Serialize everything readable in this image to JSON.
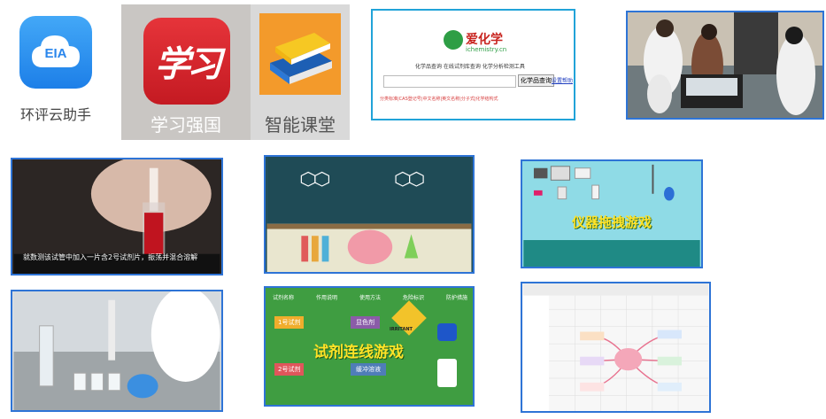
{
  "apps": {
    "eia": {
      "icon_text": "EIA",
      "label": "环评云助手"
    },
    "xuexi": {
      "icon_text": "学习",
      "label": "学习强国"
    },
    "zhineng": {
      "label": "智能课堂"
    }
  },
  "website": {
    "logo_text": "爱化学",
    "logo_sub": "ichemistry.cn",
    "line1": "化学品查询  在线试剂库查询  化学分析检测工具",
    "search_button": "化学品查询",
    "link1": "设置",
    "link2": "帮助",
    "footer": "分类标准|CAS登记号|中文名称|英文名称|分子式|化学结构式"
  },
  "videos": {
    "tube_caption": "就数测该试管中加入一片含2号试剂片，振荡并混合溶解"
  },
  "games": {
    "instrument_title": "仪器拖拽游戏",
    "reagent_title": "试剂连线游戏",
    "reagent_headers": [
      "试剂名称",
      "作用说明",
      "使用方法",
      "危险标识",
      "防护措施"
    ],
    "reagent_tags": [
      "1号试剂",
      "2号试剂",
      "显色剂",
      "缓冲溶液"
    ],
    "hazard_label": "IRRITANT"
  },
  "colors": {
    "frame": "#2e74d6",
    "eia_blue": "#2a86ec",
    "xuexi_red": "#d42128",
    "reagent_green": "#3f9d41",
    "game_yellow": "#ffe227"
  }
}
